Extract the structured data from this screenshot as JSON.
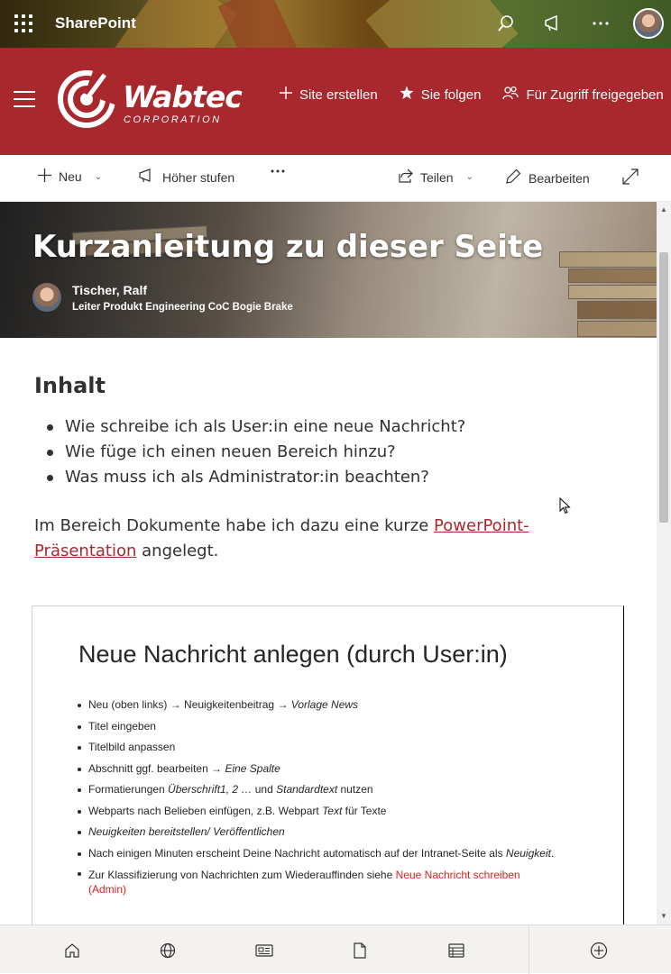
{
  "suite_bar": {
    "app_name": "SharePoint"
  },
  "site_header": {
    "logo_word": "Wabtec",
    "logo_subtitle": "CORPORATION",
    "actions": [
      {
        "label": "Site erstellen",
        "icon": "plus-icon"
      },
      {
        "label": "Sie folgen",
        "icon": "star-filled-icon"
      },
      {
        "label": "Für Zugriff freigegeben",
        "icon": "people-icon"
      }
    ]
  },
  "command_bar": {
    "new_label": "Neu",
    "promote_label": "Höher stufen",
    "share_label": "Teilen",
    "edit_label": "Bearbeiten"
  },
  "hero": {
    "title": "Kurzanleitung zu dieser Seite",
    "author_name": "Tischer, Ralf",
    "author_title": "Leiter Produkt Engineering CoC Bogie Brake"
  },
  "content": {
    "heading": "Inhalt",
    "toc": [
      "Wie schreibe ich als User:in eine neue Nachricht?",
      "Wie füge ich einen neuen Bereich hinzu?",
      "Was muss ich als Administrator:in beachten?"
    ],
    "para_before_link": "Im Bereich Dokumente habe ich dazu eine kurze ",
    "link_text": "PowerPoint-Präsentation",
    "para_after_link": " angelegt."
  },
  "slide": {
    "title": "Neue Nachricht anlegen (durch User:in)",
    "items": {
      "i1_a": "Neu (oben links) → Neuigkeitenbeitrag → ",
      "i1_b": "Vorlage News",
      "i2": "Titel eingeben",
      "i3": "Titelbild anpassen",
      "i4_a": "Abschnitt ggf. bearbeiten → ",
      "i4_b": "Eine Spalte",
      "i5_a": "Formatierungen ",
      "i5_b": "Überschrift1, 2 …",
      "i5_c": " und ",
      "i5_d": "Standardtext",
      "i5_e": " nutzen",
      "i6_a": "Webparts nach Belieben einfügen, z.B. Webpart ",
      "i6_b": "Text",
      "i6_c": " für Texte",
      "i7": "Neuigkeiten bereitstellen/ Veröffentlichen",
      "i8_a": "Nach einigen Minuten erscheint Deine Nachricht automatisch auf der Intranet-Seite als ",
      "i8_b": "Neuigkeit",
      "i8_c": ".",
      "i9_a": "Zur Klassifizierung von Nachrichten zum Wiederauffinden siehe ",
      "i9_b": "Neue Nachricht schreiben (Admin)"
    }
  },
  "bottom_bar": {
    "icons": [
      "home-icon",
      "globe-icon",
      "news-icon",
      "document-icon",
      "list-icon",
      "add-circle-icon"
    ]
  },
  "colors": {
    "brand_red": "#a8282e",
    "link_red": "#a8282e",
    "slide_red": "#e02020"
  }
}
